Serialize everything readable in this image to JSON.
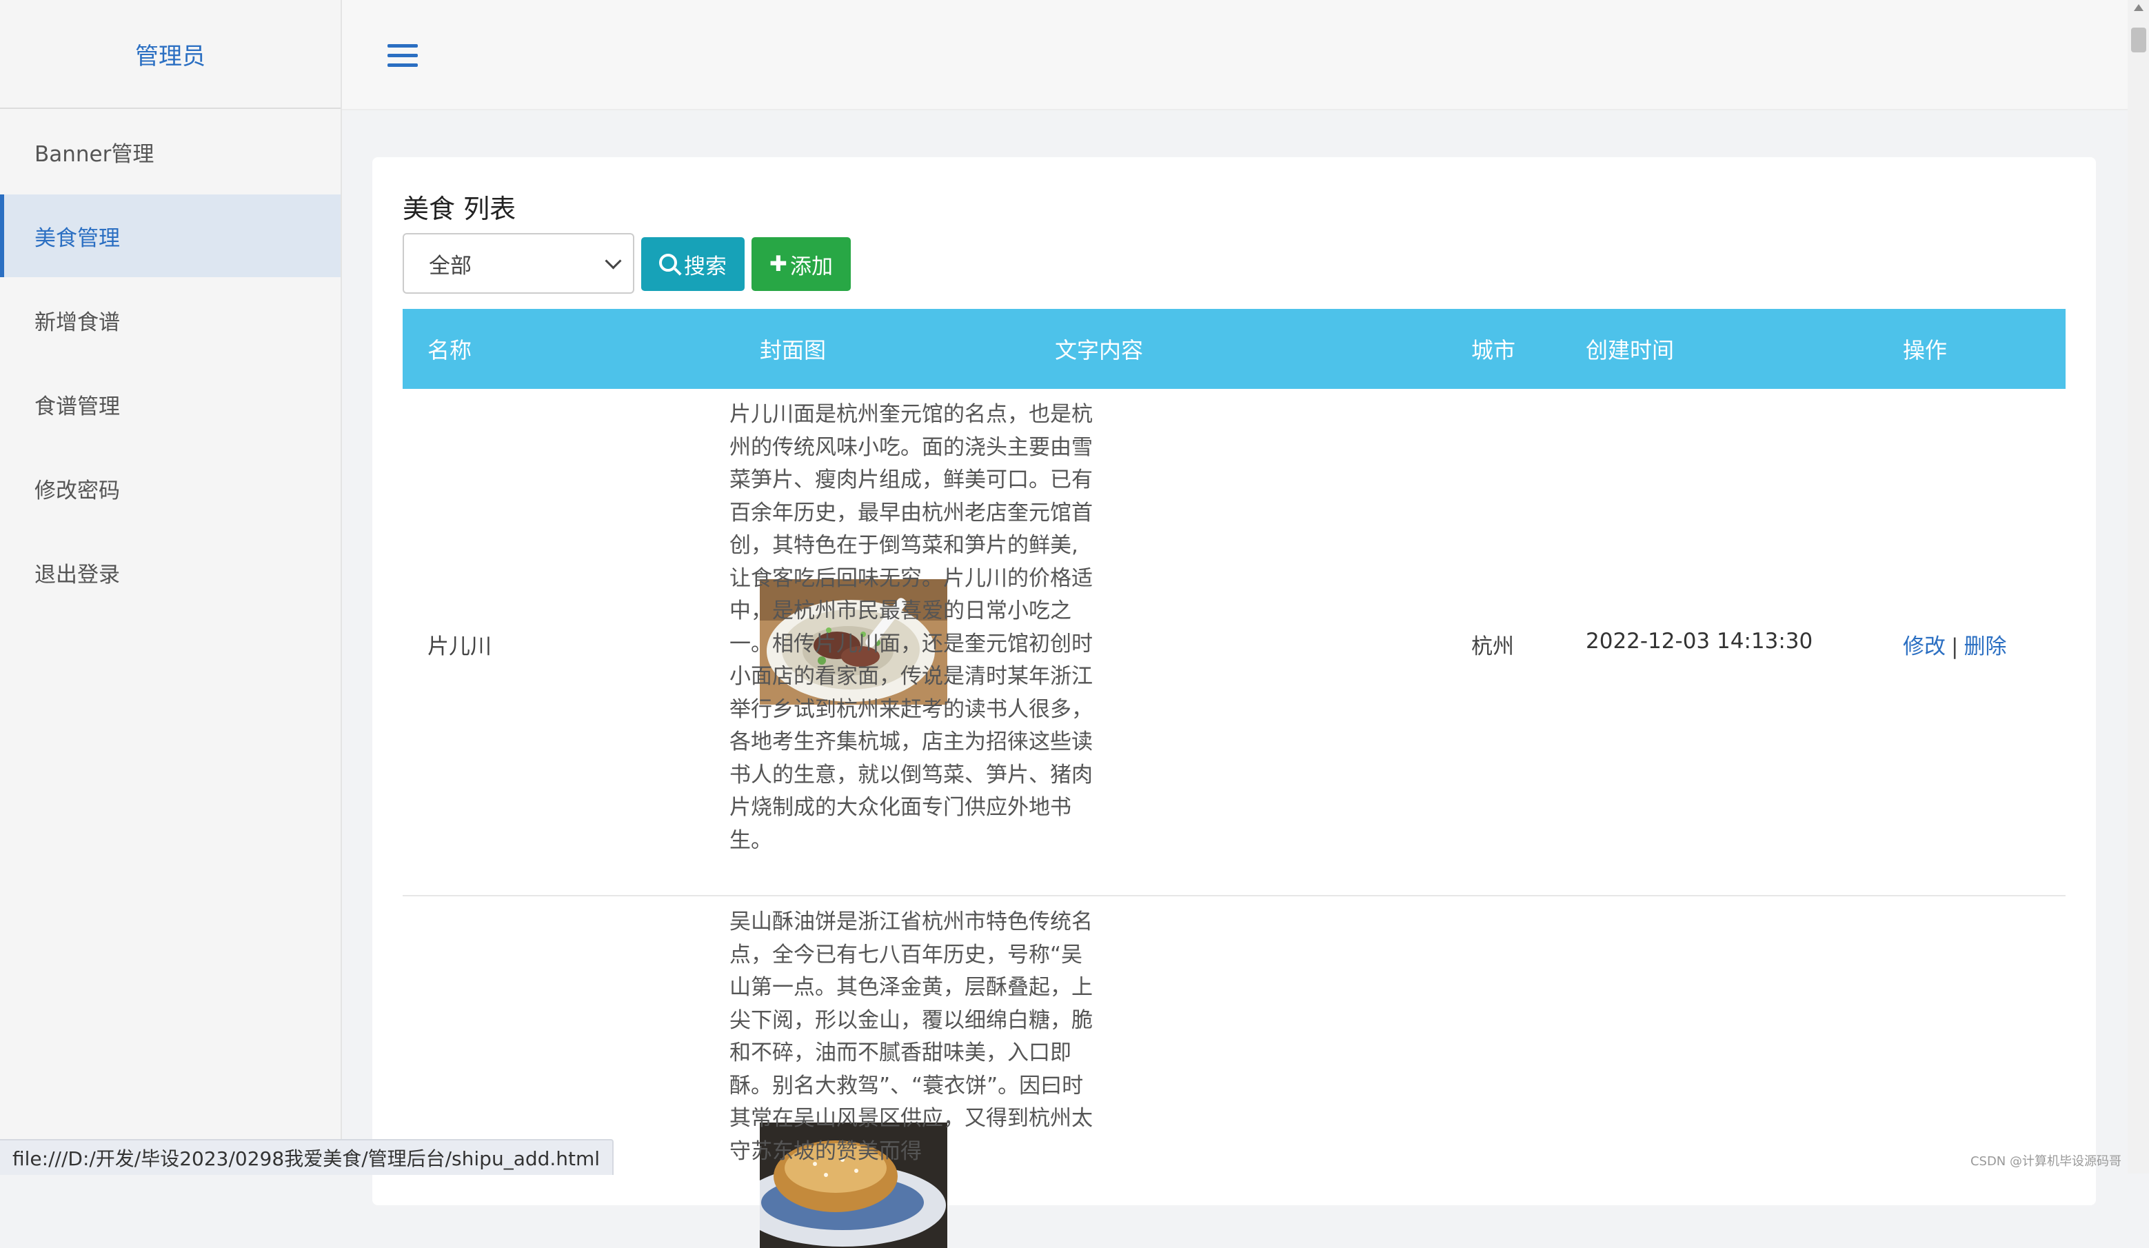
{
  "sidebar": {
    "title": "管理员",
    "items": [
      {
        "label": "Banner管理"
      },
      {
        "label": "美食管理"
      },
      {
        "label": "新增食谱"
      },
      {
        "label": "食谱管理"
      },
      {
        "label": "修改密码"
      },
      {
        "label": "退出登录"
      }
    ],
    "active_index": 1
  },
  "header": {
    "menu_icon": "hamburger-icon"
  },
  "main": {
    "title": "美食 列表",
    "filter": {
      "selected": "全部"
    },
    "buttons": {
      "search": "搜索",
      "add": "添加"
    },
    "table": {
      "columns": [
        "名称",
        "封面图",
        "文字内容",
        "城市",
        "创建时间",
        "操作"
      ],
      "rows": [
        {
          "name": "片儿川",
          "content": "片儿川面是杭州奎元馆的名点，也是杭州的传统风味小吃。面的浇头主要由雪菜笋片、瘦肉片组成，鲜美可口。已有百余年历史，最早由杭州老店奎元馆首创，其特色在于倒笃菜和笋片的鲜美,让食客吃后回味无穷。片儿川的价格适中，是杭州市民最喜爱的日常小吃之一。相传片儿川面，还是奎元馆初创时小面店的看家面，传说是清时某年浙江举行乡试到杭州来赶考的读书人很多，各地考生齐集杭城，店主为招徕这些读书人的生意，就以倒笃菜、笋片、猪肉片烧制成的大众化面专门供应外地书生。",
          "city": "杭州",
          "created": "2022-12-03 14:13:30",
          "edit": "修改",
          "separator": "|",
          "delete": "删除"
        },
        {
          "content": "吴山酥油饼是浙江省杭州市特色传统名点，全今已有七八百年历史，号称“吴山第一点。其色泽金黄，层酥叠起，上尖下阅，形以金山，覆以细绵白糖，脆和不碎，油而不腻香甜味美，入口即酥。别名大救驾”、“蓑衣饼”。因曰时其常在吴山风景区供应，又得到杭州太守苏东坡的赞美而得"
        }
      ]
    }
  },
  "statusbar": {
    "url": "file:///D:/开发/毕设2023/0298我爱美食/管理后台/shipu_add.html"
  },
  "watermark": "CSDN @计算机毕设源码哥",
  "colors": {
    "accent": "#2b6fc2",
    "table_header": "#4dc2ea",
    "search_button": "#17a2b8",
    "add_button": "#28a745"
  }
}
